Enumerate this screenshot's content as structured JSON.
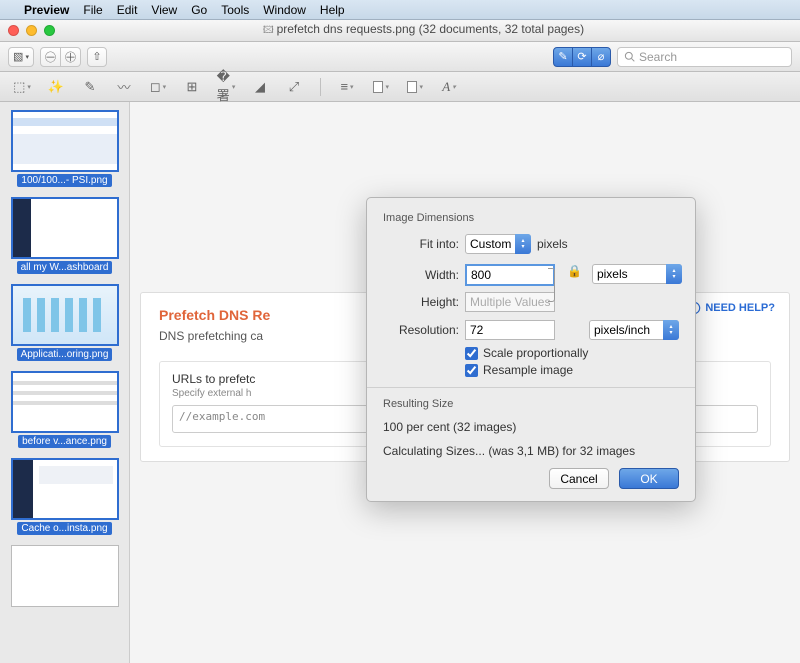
{
  "menubar": {
    "app": "Preview",
    "items": [
      "File",
      "Edit",
      "View",
      "Go",
      "Tools",
      "Window",
      "Help"
    ]
  },
  "window": {
    "title": "prefetch dns requests.png (32 documents, 32 total pages)",
    "search_placeholder": "Search"
  },
  "sidebar": {
    "thumbs": [
      {
        "label": "100/100...- PSI.png",
        "selected": true
      },
      {
        "label": "all my W...ashboard",
        "selected": true
      },
      {
        "label": "Applicati...oring.png",
        "selected": true
      },
      {
        "label": "before v...ance.png",
        "selected": true
      },
      {
        "label": "Cache o...insta.png",
        "selected": true
      },
      {
        "label": "",
        "selected": false
      }
    ]
  },
  "document": {
    "heading_partial": "Prefetch DNS Re",
    "subtext_partial": "DNS prefetching ca",
    "inner_label": "URLs to prefetc",
    "inner_hint": "Specify external h",
    "textarea_value": "//example.com",
    "need_help": "NEED HELP?"
  },
  "dialog": {
    "section1_title": "Image Dimensions",
    "fit_label": "Fit into:",
    "fit_value": "Custom",
    "fit_unit": "pixels",
    "width_label": "Width:",
    "width_value": "800",
    "height_label": "Height:",
    "height_value": "Multiple Values",
    "wh_unit": "pixels",
    "res_label": "Resolution:",
    "res_value": "72",
    "res_unit": "pixels/inch",
    "scale_label": "Scale proportionally",
    "resample_label": "Resample image",
    "section2_title": "Resulting Size",
    "result_percent": "100 per cent (32 images)",
    "result_calc": "Calculating Sizes... (was 3,1 MB) for 32 images",
    "cancel": "Cancel",
    "ok": "OK"
  }
}
